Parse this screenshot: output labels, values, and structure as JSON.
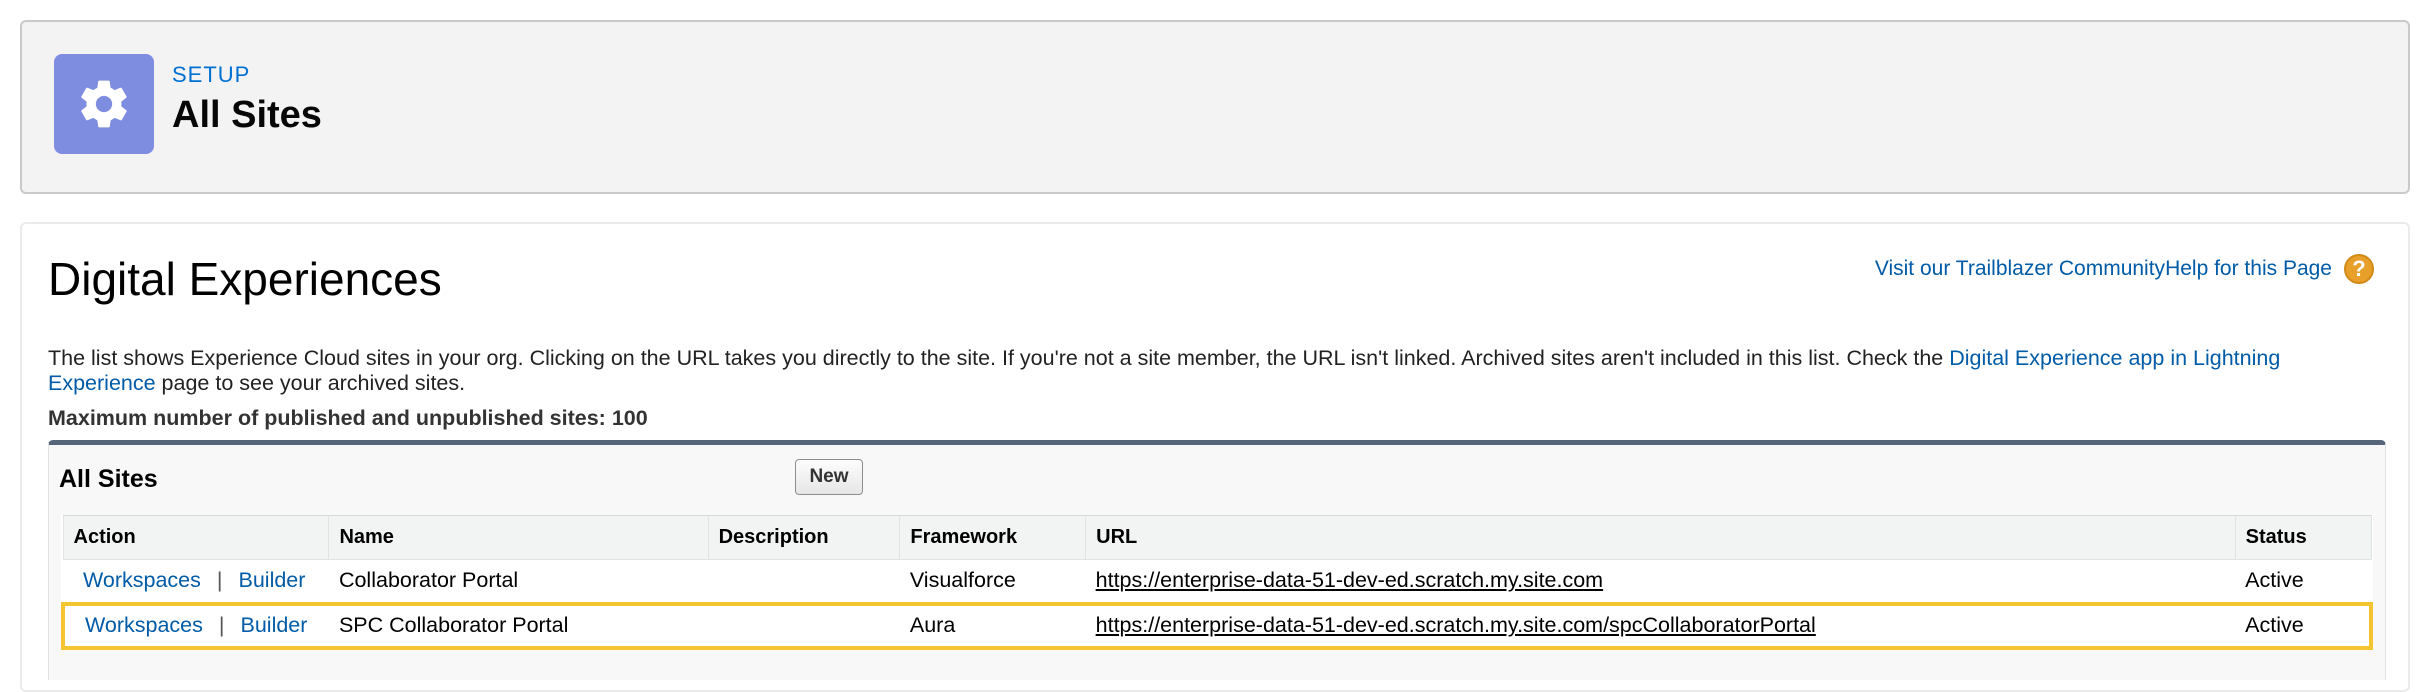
{
  "header": {
    "setup_label": "SETUP",
    "title": "All Sites",
    "icon": "gear-icon",
    "icon_bg": "#7f8de1"
  },
  "main": {
    "heading": "Digital Experiences",
    "help": {
      "trailblazer_link": "Visit our Trailblazer Community",
      "help_link": "Help for this Page",
      "icon": "question-icon",
      "icon_label": "?"
    },
    "description": {
      "text_before": "The list shows Experience Cloud sites in your org. Clicking on the URL takes you directly to the site. If you're not a site member, the URL isn't linked. Archived sites aren't included in this list. Check the ",
      "link": "Digital Experience app in Lightning Experience",
      "text_after": " page to see your archived sites."
    },
    "max_sites": "Maximum number of published and unpublished sites: 100"
  },
  "sites_list": {
    "title": "All Sites",
    "new_button": "New",
    "columns": [
      "Action",
      "Name",
      "Description",
      "Framework",
      "URL",
      "Status"
    ],
    "action_separator": "|",
    "rows": [
      {
        "workspaces": "Workspaces",
        "builder": "Builder",
        "name": "Collaborator Portal",
        "description": "",
        "framework": "Visualforce",
        "url": "https://enterprise-data-51-dev-ed.scratch.my.site.com",
        "status": "Active"
      },
      {
        "workspaces": "Workspaces",
        "builder": "Builder",
        "name": "SPC Collaborator Portal",
        "description": "",
        "framework": "Aura",
        "url": "https://enterprise-data-51-dev-ed.scratch.my.site.com/spcCollaboratorPortal",
        "status": "Active"
      }
    ]
  },
  "colors": {
    "link": "#015ba7",
    "highlight": "#f5c431",
    "list_border": "#56657a"
  }
}
